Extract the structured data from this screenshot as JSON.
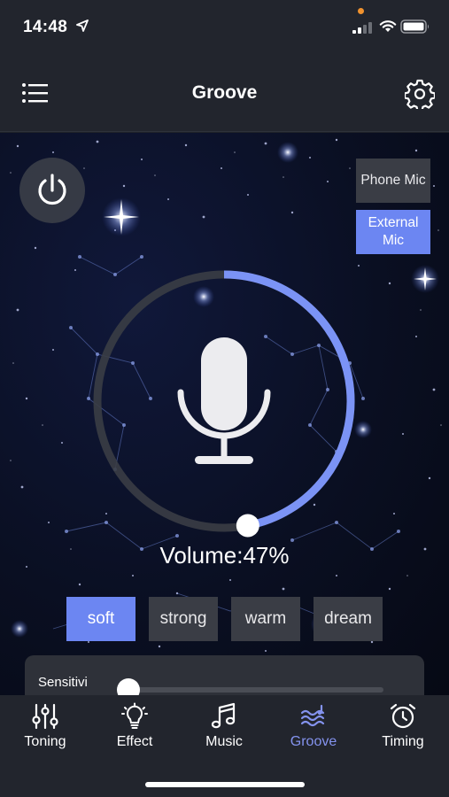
{
  "status_bar": {
    "time": "14:48"
  },
  "nav": {
    "title": "Groove"
  },
  "mic_sources": {
    "phone": "Phone Mic",
    "external_line1": "External",
    "external_line2": "Mic",
    "selected": "External Mic"
  },
  "volume": {
    "label": "Volume:47%",
    "percent": 47
  },
  "modes": {
    "items": [
      "soft",
      "strong",
      "warm",
      "dream"
    ],
    "selected": "soft"
  },
  "sensitivity": {
    "label": "Sensitivi",
    "value": 0
  },
  "tabs": [
    {
      "label": "Toning",
      "icon": "sliders-icon"
    },
    {
      "label": "Effect",
      "icon": "lightbulb-icon"
    },
    {
      "label": "Music",
      "icon": "music-note-icon"
    },
    {
      "label": "Groove",
      "icon": "sound-wave-icon"
    },
    {
      "label": "Timing",
      "icon": "alarm-clock-icon"
    }
  ],
  "active_tab": "Groove",
  "colors": {
    "accent": "#6c86f2",
    "background": "#22252d",
    "button": "#3a3d45",
    "tab_active": "#8493ee"
  }
}
